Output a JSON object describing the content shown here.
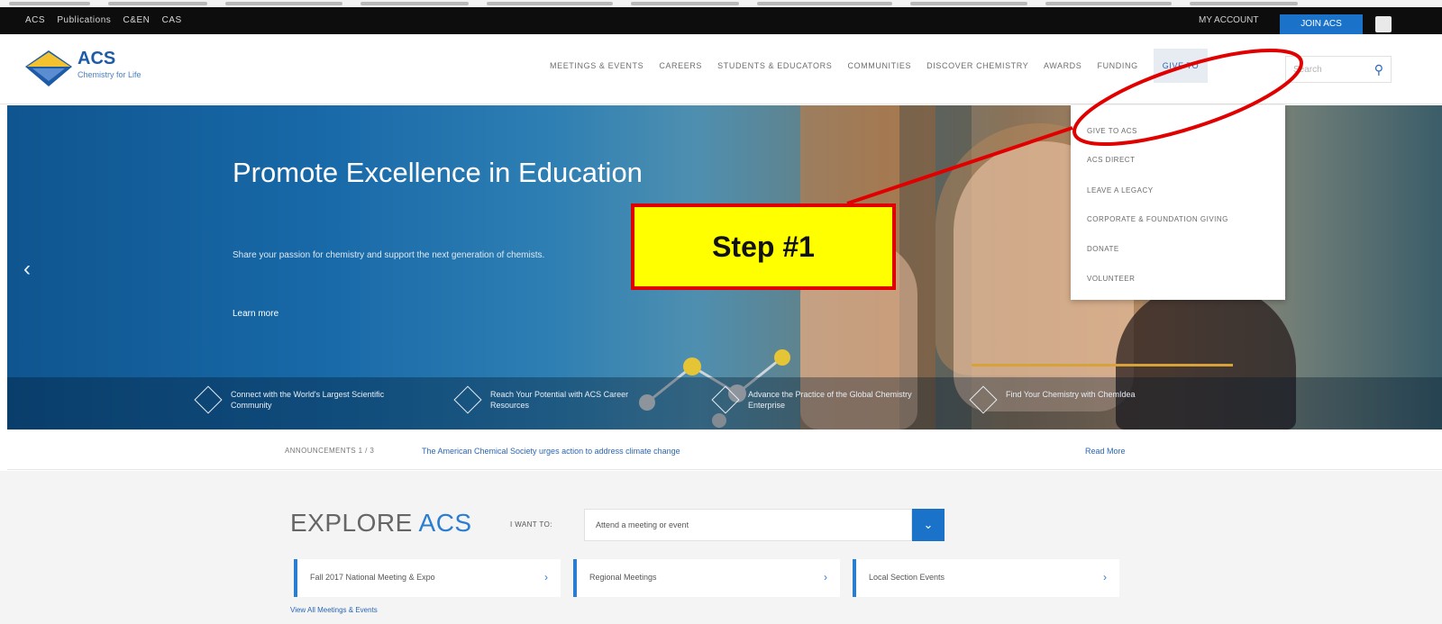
{
  "utility_bar": {
    "links": [
      "ACS",
      "Publications",
      "C&EN",
      "CAS"
    ],
    "login_label": "MY ACCOUNT",
    "join_label": "JOIN ACS"
  },
  "header": {
    "logo_text": "ACS",
    "logo_tagline": "Chemistry for Life",
    "nav_items": [
      "MEETINGS & EVENTS",
      "CAREERS",
      "STUDENTS & EDUCATORS",
      "COMMUNITIES",
      "DISCOVER CHEMISTRY",
      "AWARDS",
      "FUNDING",
      "GIVE TO"
    ],
    "search_placeholder": "Search"
  },
  "hero": {
    "title": "Promote Excellence in Education",
    "subtitle": "Share your passion for chemistry and support the next generation of chemists.",
    "cta": "Learn more",
    "quick_links": [
      "Connect with the World's Largest Scientific Community",
      "Reach Your Potential with ACS Career Resources",
      "Advance the Practice of the Global Chemistry Enterprise",
      "Find Your Chemistry with ChemIdea"
    ]
  },
  "dropdown": {
    "items": [
      "GIVE TO ACS",
      "ACS DIRECT",
      "LEAVE A LEGACY",
      "CORPORATE & FOUNDATION GIVING",
      "DONATE",
      "VOLUNTEER"
    ]
  },
  "annotation": {
    "step_label": "Step #1",
    "color": "#e00000",
    "fill": "#ffff00"
  },
  "announcement": {
    "label": "ANNOUNCEMENTS",
    "pager": "1 / 3",
    "message": "The American Chemical Society urges action to address climate change",
    "more": "Read More"
  },
  "explore": {
    "heading_main": "EXPLORE",
    "heading_accent": "ACS",
    "want_label": "I WANT TO:",
    "select_value": "Attend a meeting or event",
    "cards": [
      "Fall 2017 National Meeting & Expo",
      "Regional Meetings",
      "Local Section Events"
    ],
    "footnote": "View All Meetings & Events"
  },
  "colors": {
    "brand_blue": "#1a73c9",
    "hero_blue": "#0f5590",
    "accent_gold": "#d8a23a"
  }
}
